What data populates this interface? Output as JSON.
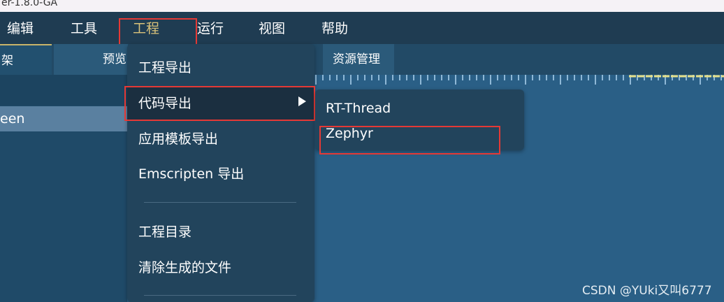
{
  "window": {
    "title": "er-1.8.0-GA"
  },
  "menubar": {
    "items": [
      "编辑",
      "工具",
      "工程",
      "运行",
      "视图",
      "帮助"
    ],
    "active_index": 2
  },
  "tabs": [
    "架",
    "预览",
    "资源管理"
  ],
  "left_panel": {
    "selected_item": "een"
  },
  "project_menu": {
    "items": [
      "工程导出",
      "代码导出",
      "应用模板导出",
      "Emscripten 导出",
      "工程目录",
      "清除生成的文件"
    ],
    "submenu_arrow_icon": "triangle-right-icon"
  },
  "code_export_submenu": {
    "items": [
      "RT-Thread",
      "Zephyr"
    ]
  },
  "watermark": "CSDN @YUki又叫6777",
  "colors": {
    "highlight_border": "#e53935",
    "active_menu_text": "#d9c27a",
    "menu_background": "#22445c",
    "canvas_background": "#2a5f86",
    "ruler_marker": "#e6e08a"
  }
}
